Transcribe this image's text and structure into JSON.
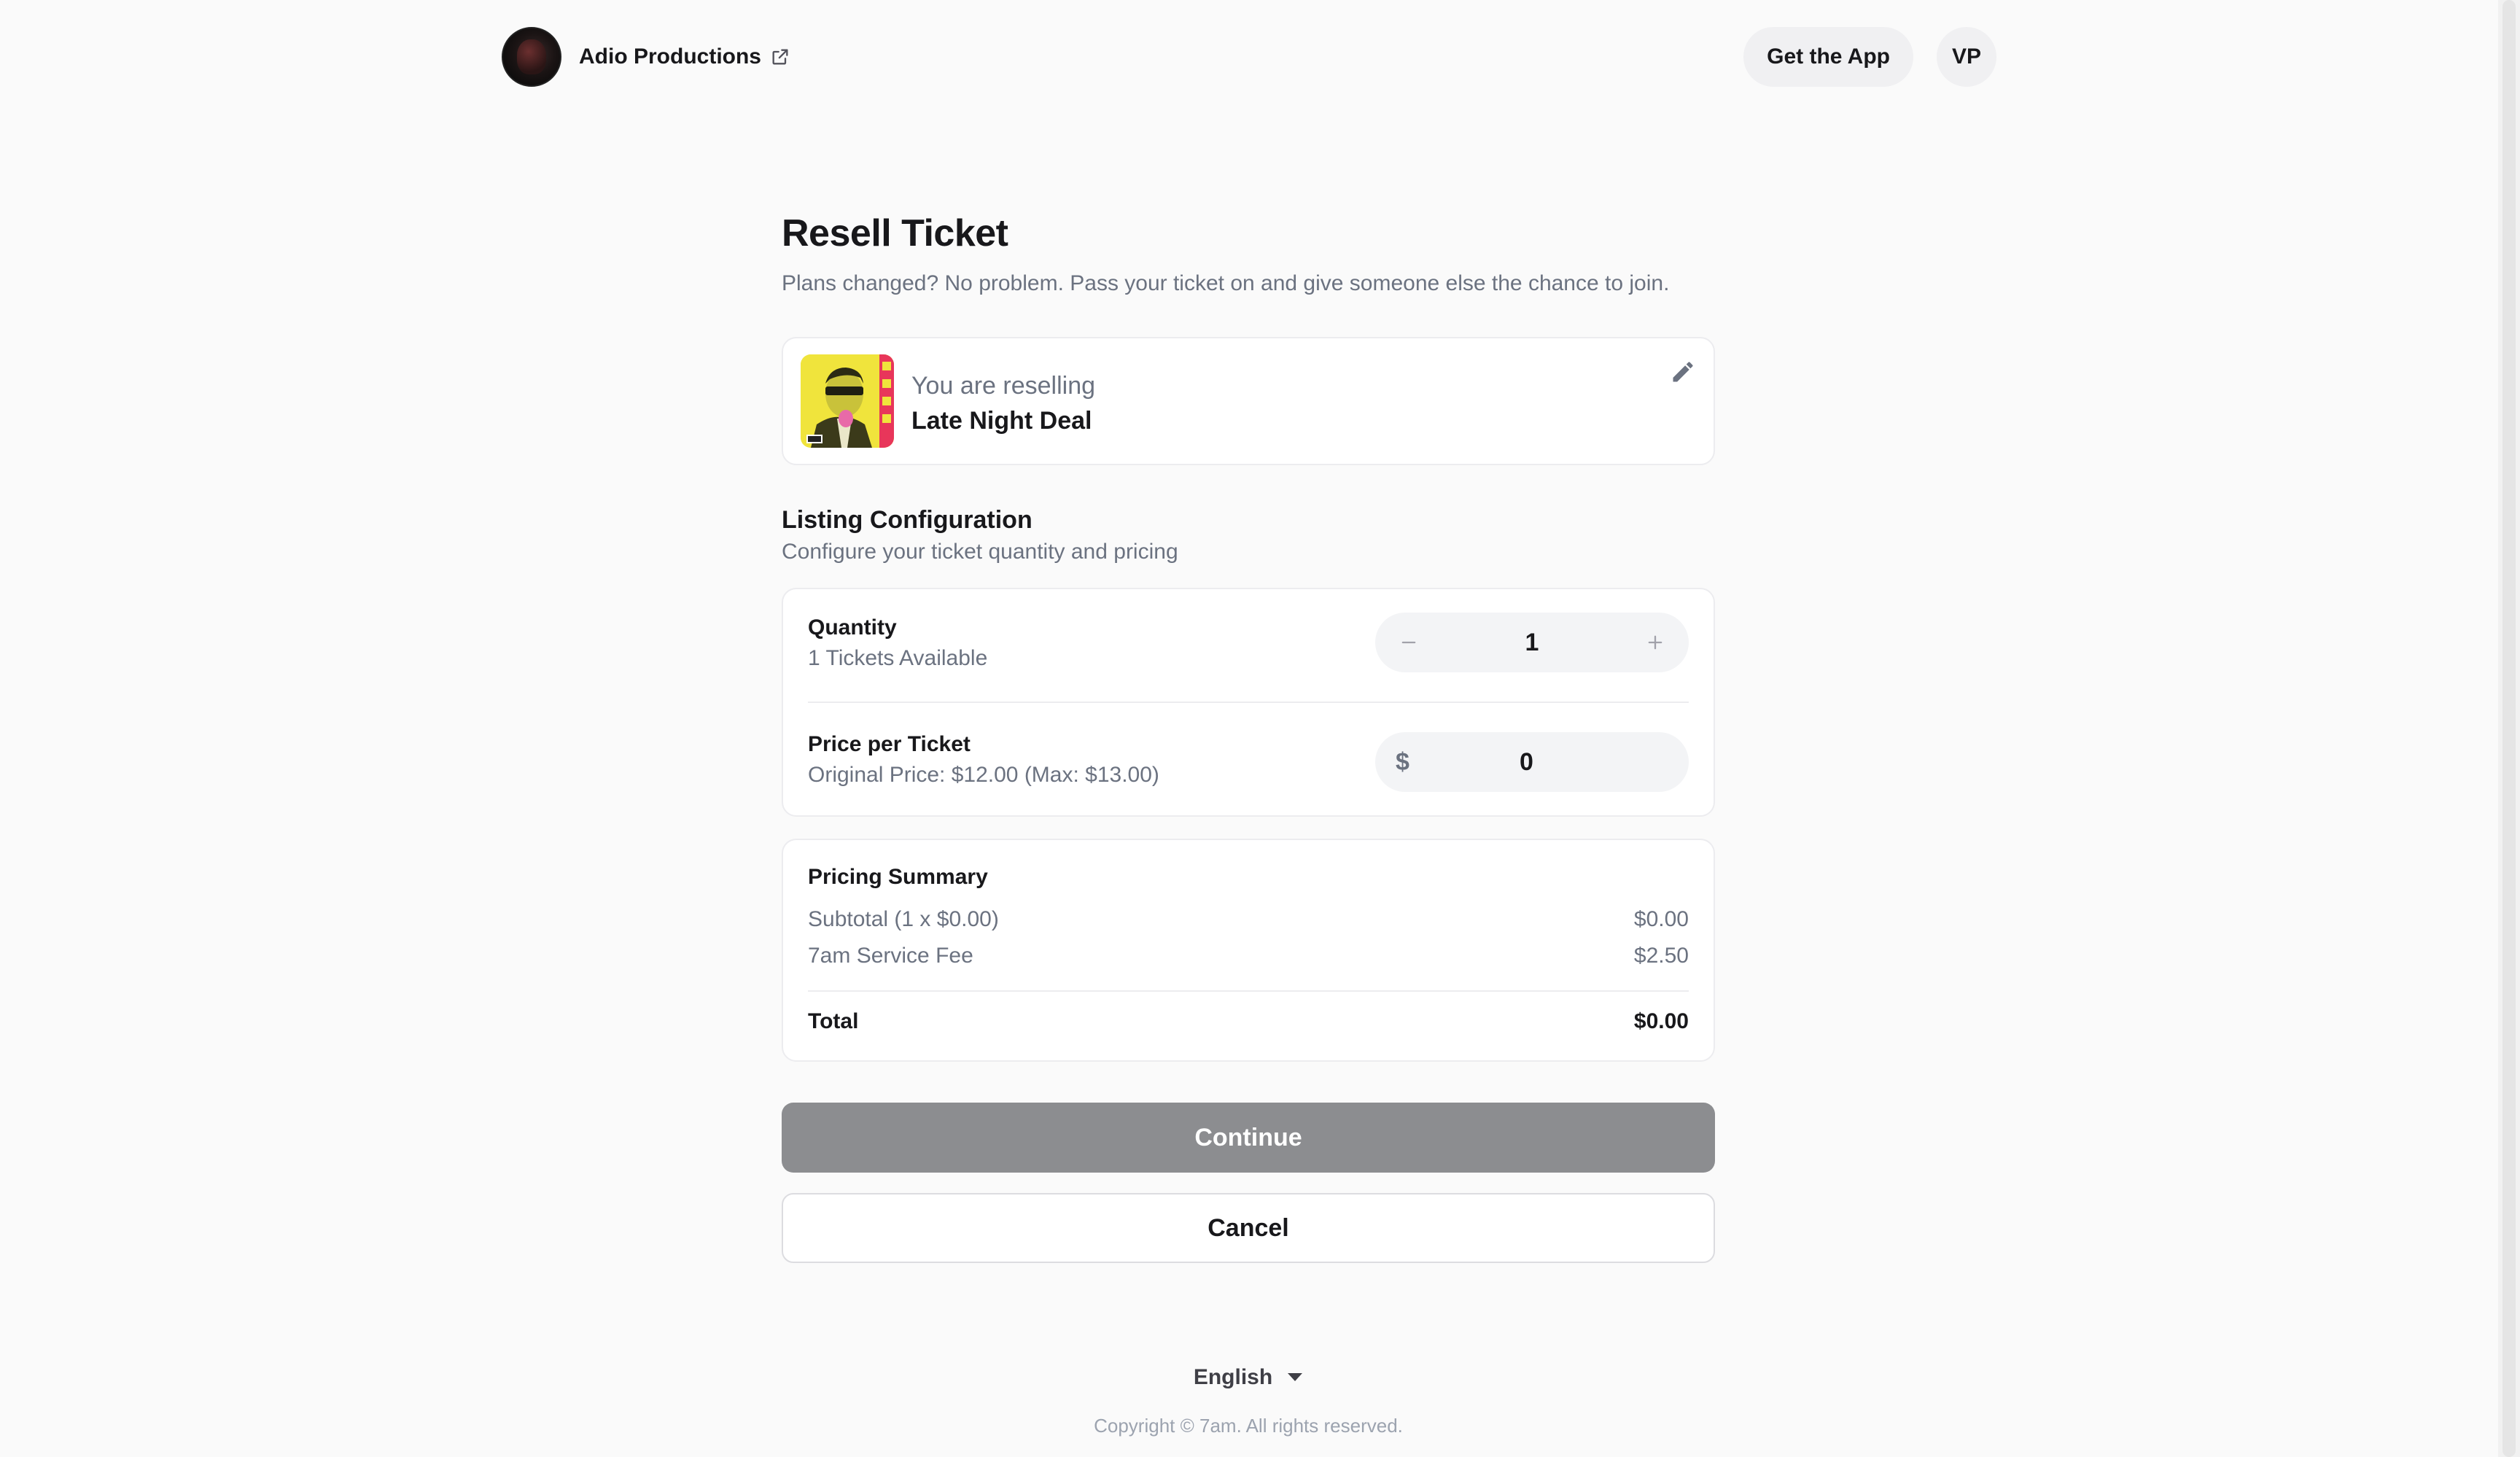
{
  "header": {
    "org_name": "Adio Productions",
    "get_app_label": "Get the App",
    "avatar_initials": "VP"
  },
  "page": {
    "title": "Resell Ticket",
    "subtitle": "Plans changed? No problem. Pass your ticket on and give someone else the chance to join."
  },
  "reselling": {
    "label": "You are reselling",
    "event_name": "Late Night Deal"
  },
  "listing": {
    "title": "Listing Configuration",
    "subtitle": "Configure your ticket quantity and pricing",
    "quantity_label": "Quantity",
    "quantity_sub": "1 Tickets Available",
    "quantity_value": "1",
    "price_label": "Price per Ticket",
    "price_sub": "Original Price: $12.00 (Max: $13.00)",
    "price_currency": "$",
    "price_value": "0"
  },
  "summary": {
    "title": "Pricing Summary",
    "subtotal_label": "Subtotal (1 x $0.00)",
    "subtotal_value": "$0.00",
    "fee_label": "7am Service Fee",
    "fee_value": "$2.50",
    "total_label": "Total",
    "total_value": "$0.00"
  },
  "actions": {
    "continue_label": "Continue",
    "cancel_label": "Cancel"
  },
  "footer": {
    "language": "English",
    "copyright": "Copyright © 7am. All rights reserved."
  },
  "colors": {
    "background": "#fafafa",
    "continue_disabled": "#8c8d90",
    "muted_text": "#6b7280"
  }
}
